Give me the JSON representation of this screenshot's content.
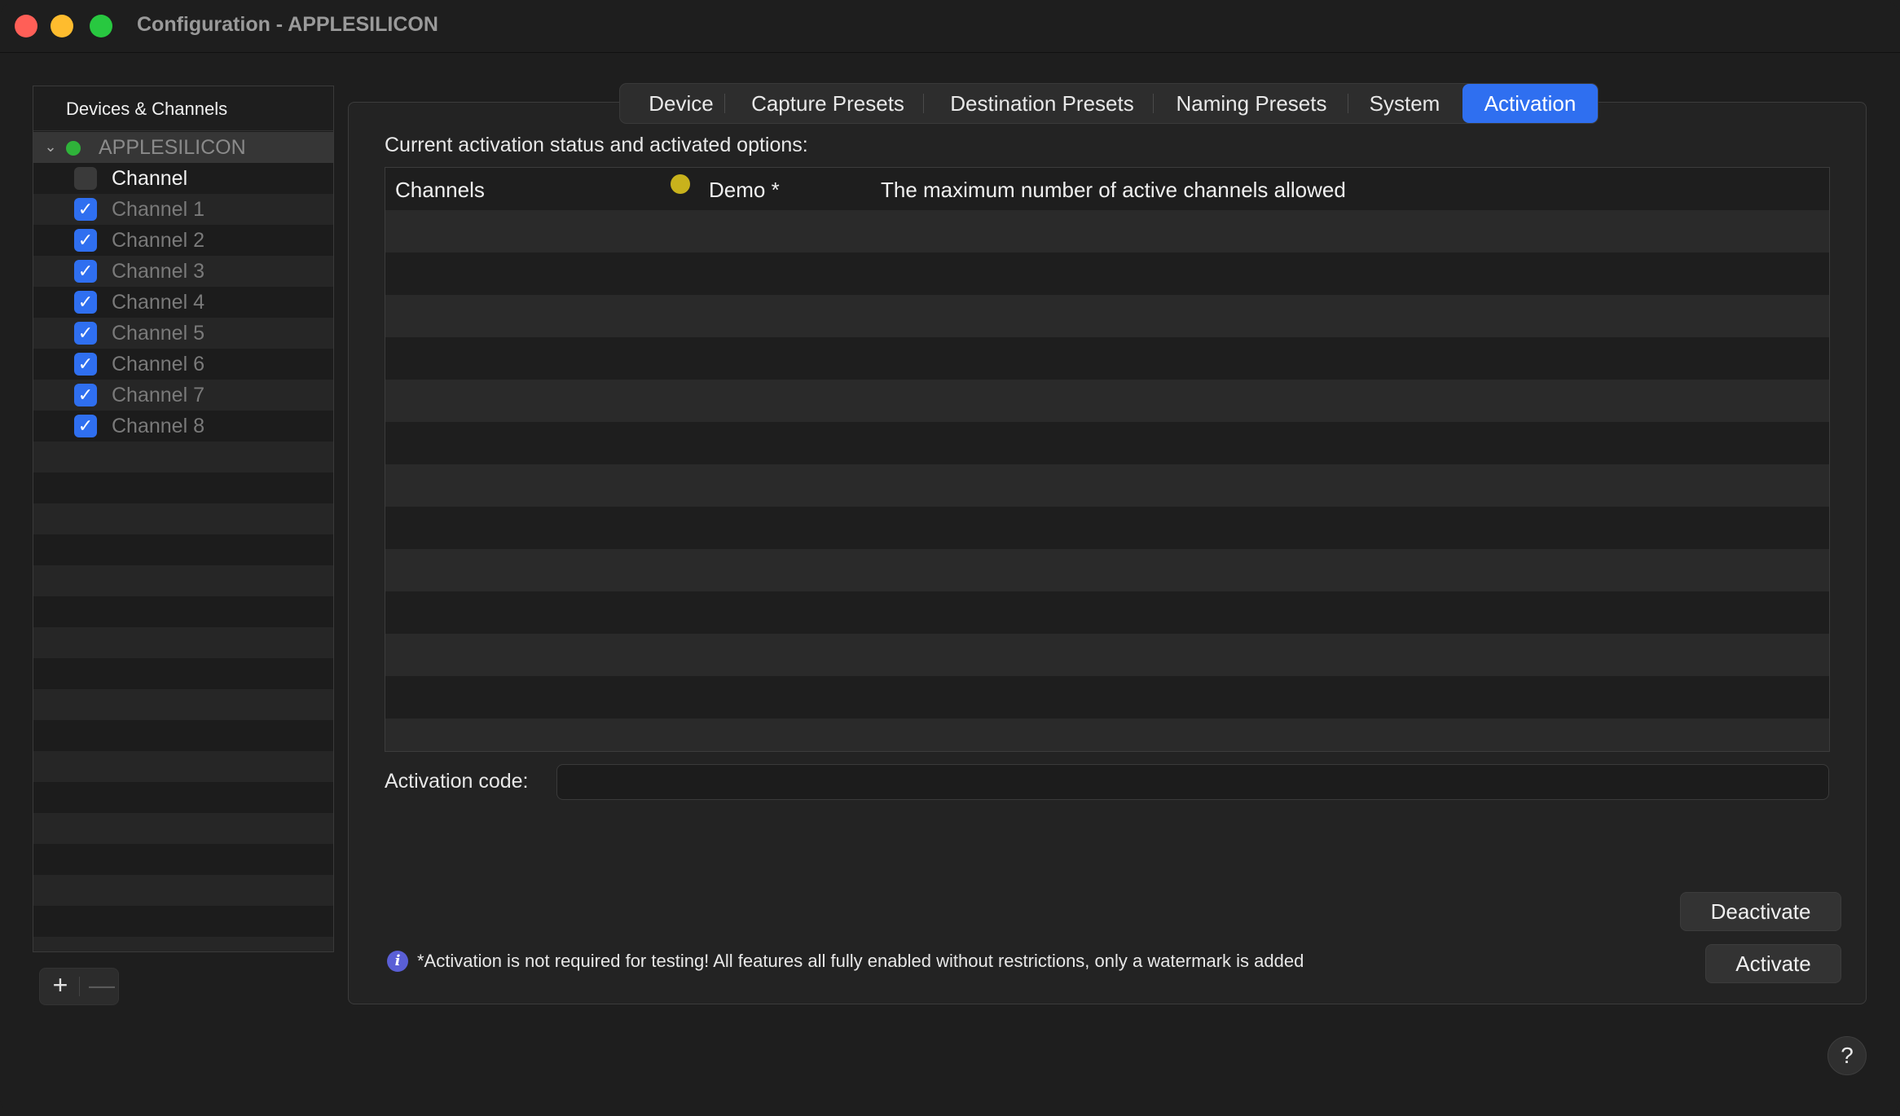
{
  "window": {
    "title": "Configuration - APPLESILICON"
  },
  "sidebar": {
    "header": "Devices & Channels",
    "device": {
      "label": "APPLESILICON",
      "status_color": "#2fb33a",
      "expanded": true
    },
    "channel_group": {
      "label": "Channel",
      "checked": false
    },
    "channels": [
      {
        "label": "Channel 1",
        "checked": true
      },
      {
        "label": "Channel 2",
        "checked": true
      },
      {
        "label": "Channel 3",
        "checked": true
      },
      {
        "label": "Channel 4",
        "checked": true
      },
      {
        "label": "Channel 5",
        "checked": true
      },
      {
        "label": "Channel 6",
        "checked": true
      },
      {
        "label": "Channel 7",
        "checked": true
      },
      {
        "label": "Channel 8",
        "checked": true
      }
    ],
    "add_label": "+",
    "remove_label": "—"
  },
  "tabs": [
    {
      "label": "Device",
      "active": false
    },
    {
      "label": "Capture Presets",
      "active": false
    },
    {
      "label": "Destination Presets",
      "active": false
    },
    {
      "label": "Naming Presets",
      "active": false
    },
    {
      "label": "System",
      "active": false
    },
    {
      "label": "Activation",
      "active": true
    }
  ],
  "activation": {
    "status_label": "Current activation status and activated options:",
    "table": {
      "rows": [
        {
          "option": "Channels",
          "status_color": "#c8b21c",
          "status": "Demo *",
          "description": "The maximum number of active channels allowed"
        }
      ]
    },
    "code_label": "Activation code:",
    "code_value": "",
    "code_placeholder": "",
    "deactivate_label": "Deactivate",
    "activate_label": "Activate",
    "info_text": "*Activation is not required for testing! All features all fully enabled without restrictions, only a watermark is added"
  },
  "help_label": "?",
  "colors": {
    "accent": "#2f6ff0",
    "background": "#1e1e1e"
  }
}
